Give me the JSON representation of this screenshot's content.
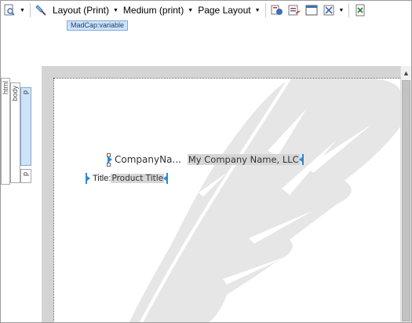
{
  "toolbar": {
    "layout_label": "Layout (Print)",
    "medium_label": "Medium (print)",
    "page_layout_label": "Page Layout"
  },
  "tag_hint": "MadCap:variable",
  "structure_bar": {
    "html": "html",
    "body": "body",
    "p1": "p",
    "p2": "p"
  },
  "content": {
    "company_label": "CompanyNa...",
    "company_value": "My Company Name, LLC",
    "title_label": "Title: ",
    "title_value": "Product Title"
  },
  "colors": {
    "marker": "#2d8ad6",
    "variable_bg": "#d6d6d6",
    "tag_bg": "#cfe3f8",
    "editor_gray": "#d4d4d4"
  }
}
